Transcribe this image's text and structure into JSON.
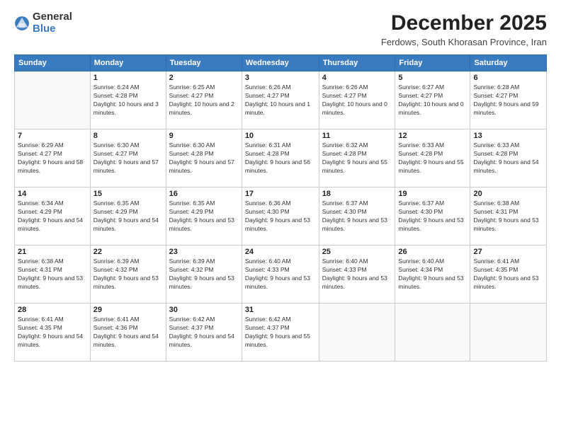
{
  "logo": {
    "general": "General",
    "blue": "Blue"
  },
  "header": {
    "month": "December 2025",
    "location": "Ferdows, South Khorasan Province, Iran"
  },
  "weekdays": [
    "Sunday",
    "Monday",
    "Tuesday",
    "Wednesday",
    "Thursday",
    "Friday",
    "Saturday"
  ],
  "weeks": [
    [
      {
        "day": null
      },
      {
        "day": "1",
        "sunrise": "6:24 AM",
        "sunset": "4:28 PM",
        "daylight": "10 hours and 3 minutes."
      },
      {
        "day": "2",
        "sunrise": "6:25 AM",
        "sunset": "4:27 PM",
        "daylight": "10 hours and 2 minutes."
      },
      {
        "day": "3",
        "sunrise": "6:26 AM",
        "sunset": "4:27 PM",
        "daylight": "10 hours and 1 minute."
      },
      {
        "day": "4",
        "sunrise": "6:26 AM",
        "sunset": "4:27 PM",
        "daylight": "10 hours and 0 minutes."
      },
      {
        "day": "5",
        "sunrise": "6:27 AM",
        "sunset": "4:27 PM",
        "daylight": "10 hours and 0 minutes."
      },
      {
        "day": "6",
        "sunrise": "6:28 AM",
        "sunset": "4:27 PM",
        "daylight": "9 hours and 59 minutes."
      }
    ],
    [
      {
        "day": "7",
        "sunrise": "6:29 AM",
        "sunset": "4:27 PM",
        "daylight": "9 hours and 58 minutes."
      },
      {
        "day": "8",
        "sunrise": "6:30 AM",
        "sunset": "4:27 PM",
        "daylight": "9 hours and 57 minutes."
      },
      {
        "day": "9",
        "sunrise": "6:30 AM",
        "sunset": "4:28 PM",
        "daylight": "9 hours and 57 minutes."
      },
      {
        "day": "10",
        "sunrise": "6:31 AM",
        "sunset": "4:28 PM",
        "daylight": "9 hours and 56 minutes."
      },
      {
        "day": "11",
        "sunrise": "6:32 AM",
        "sunset": "4:28 PM",
        "daylight": "9 hours and 55 minutes."
      },
      {
        "day": "12",
        "sunrise": "6:33 AM",
        "sunset": "4:28 PM",
        "daylight": "9 hours and 55 minutes."
      },
      {
        "day": "13",
        "sunrise": "6:33 AM",
        "sunset": "4:28 PM",
        "daylight": "9 hours and 54 minutes."
      }
    ],
    [
      {
        "day": "14",
        "sunrise": "6:34 AM",
        "sunset": "4:29 PM",
        "daylight": "9 hours and 54 minutes."
      },
      {
        "day": "15",
        "sunrise": "6:35 AM",
        "sunset": "4:29 PM",
        "daylight": "9 hours and 54 minutes."
      },
      {
        "day": "16",
        "sunrise": "6:35 AM",
        "sunset": "4:29 PM",
        "daylight": "9 hours and 53 minutes."
      },
      {
        "day": "17",
        "sunrise": "6:36 AM",
        "sunset": "4:30 PM",
        "daylight": "9 hours and 53 minutes."
      },
      {
        "day": "18",
        "sunrise": "6:37 AM",
        "sunset": "4:30 PM",
        "daylight": "9 hours and 53 minutes."
      },
      {
        "day": "19",
        "sunrise": "6:37 AM",
        "sunset": "4:30 PM",
        "daylight": "9 hours and 53 minutes."
      },
      {
        "day": "20",
        "sunrise": "6:38 AM",
        "sunset": "4:31 PM",
        "daylight": "9 hours and 53 minutes."
      }
    ],
    [
      {
        "day": "21",
        "sunrise": "6:38 AM",
        "sunset": "4:31 PM",
        "daylight": "9 hours and 53 minutes."
      },
      {
        "day": "22",
        "sunrise": "6:39 AM",
        "sunset": "4:32 PM",
        "daylight": "9 hours and 53 minutes."
      },
      {
        "day": "23",
        "sunrise": "6:39 AM",
        "sunset": "4:32 PM",
        "daylight": "9 hours and 53 minutes."
      },
      {
        "day": "24",
        "sunrise": "6:40 AM",
        "sunset": "4:33 PM",
        "daylight": "9 hours and 53 minutes."
      },
      {
        "day": "25",
        "sunrise": "6:40 AM",
        "sunset": "4:33 PM",
        "daylight": "9 hours and 53 minutes."
      },
      {
        "day": "26",
        "sunrise": "6:40 AM",
        "sunset": "4:34 PM",
        "daylight": "9 hours and 53 minutes."
      },
      {
        "day": "27",
        "sunrise": "6:41 AM",
        "sunset": "4:35 PM",
        "daylight": "9 hours and 53 minutes."
      }
    ],
    [
      {
        "day": "28",
        "sunrise": "6:41 AM",
        "sunset": "4:35 PM",
        "daylight": "9 hours and 54 minutes."
      },
      {
        "day": "29",
        "sunrise": "6:41 AM",
        "sunset": "4:36 PM",
        "daylight": "9 hours and 54 minutes."
      },
      {
        "day": "30",
        "sunrise": "6:42 AM",
        "sunset": "4:37 PM",
        "daylight": "9 hours and 54 minutes."
      },
      {
        "day": "31",
        "sunrise": "6:42 AM",
        "sunset": "4:37 PM",
        "daylight": "9 hours and 55 minutes."
      },
      {
        "day": null
      },
      {
        "day": null
      },
      {
        "day": null
      }
    ]
  ]
}
